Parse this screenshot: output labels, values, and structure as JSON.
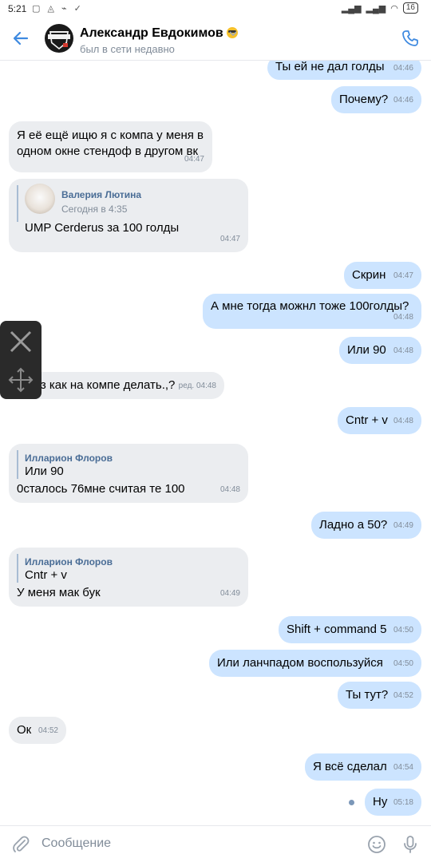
{
  "status_bar": {
    "time": "5:21",
    "battery": "16"
  },
  "header": {
    "name": "Александр Евдокимов",
    "status": "был в сети недавно",
    "avatar_text": "ГАРАНТ"
  },
  "messages": [
    {
      "text": "Ты ей не дал голды",
      "time": "04:46"
    },
    {
      "text": "Почему?",
      "time": "04:46"
    },
    {
      "line1": "Я её ещё ищю я с компа у меня в",
      "line2": "одном окне стендоф в другом вк",
      "time": "04:47"
    },
    {
      "fwd_name": "Валерия Лютина",
      "fwd_date": "Сегодня в 4:35",
      "text": "UMP Cerderus за 100 голды",
      "time": "04:47"
    },
    {
      "text": "Скрин",
      "time": "04:47"
    },
    {
      "text": "А мне тогда можнл тоже 100голды?",
      "time": "04:48"
    },
    {
      "text": "Или 90",
      "time": "04:48"
    },
    {
      "text": "Ну хз как на компе делать.,?",
      "time": "ред. 04:48"
    },
    {
      "text": "Cntr + v",
      "time": "04:48"
    },
    {
      "fwd_name": "Илларион Флоров",
      "fwd_text": "Или 90",
      "text": "0сталось 76мне считая те 100",
      "time": "04:48"
    },
    {
      "text": "Ладно а 50?",
      "time": "04:49"
    },
    {
      "fwd_name": "Илларион Флоров",
      "fwd_text": "Cntr + v",
      "text": "У меня мак бук",
      "time": "04:49"
    },
    {
      "text": "Shift + command 5",
      "time": "04:50"
    },
    {
      "text": "Или ланчпадом воспользуйся",
      "time": "04:50"
    },
    {
      "text": "Ты тут?",
      "time": "04:52"
    },
    {
      "text": "Ок",
      "time": "04:52"
    },
    {
      "text": "Я всё сделал",
      "time": "04:54"
    },
    {
      "text": "Ну",
      "time": "05:18"
    }
  ],
  "composer": {
    "placeholder": "Сообщение"
  },
  "colors": {
    "accent": "#2a5885",
    "incoming": "#ebedf0",
    "outgoing": "#cce4ff",
    "icon": "#3f8ae0"
  },
  "icons": [
    "back-arrow-icon",
    "chevron-down-icon",
    "phone-icon",
    "close-icon",
    "move-icon",
    "attach-icon",
    "emoji-icon",
    "microphone-icon"
  ]
}
